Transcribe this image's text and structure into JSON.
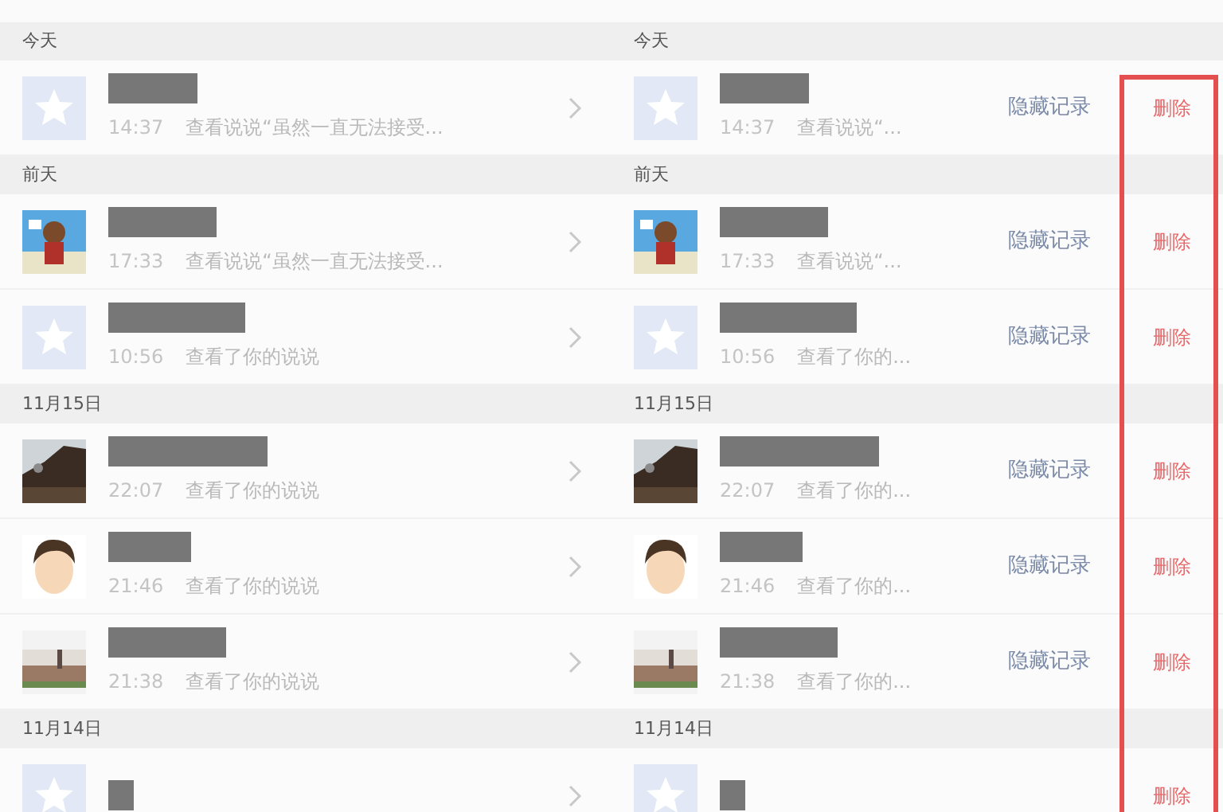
{
  "panels": [
    {
      "kind": "list",
      "sections": [
        {
          "date": "今天",
          "items": [
            {
              "kind": "star",
              "time": "14:37",
              "text": "查看说说“虽然一直无法接受..."
            }
          ]
        },
        {
          "date": "前天",
          "items": [
            {
              "time": "17:33",
              "text": "查看说说“虽然一直无法接受..."
            },
            {
              "kind": "star",
              "time": "10:56",
              "text": "查看了你的说说"
            }
          ]
        },
        {
          "date": "11月15日",
          "items": [
            {
              "time": "22:07",
              "text": "查看了你的说说"
            },
            {
              "time": "21:46",
              "text": "查看了你的说说"
            },
            {
              "time": "21:38",
              "text": "查看了你的说说"
            }
          ]
        },
        {
          "date": "11月14日",
          "items": [
            {
              "kind": "star"
            }
          ]
        }
      ]
    },
    {
      "kind": "swiped",
      "sections": [
        {
          "date": "今天",
          "items": [
            {
              "kind": "star",
              "time": "14:37",
              "text": "查看说说“...",
              "actions": [
                "隐藏记录",
                "删除"
              ]
            }
          ]
        },
        {
          "date": "前天",
          "items": [
            {
              "time": "17:33",
              "text": "查看说说“...",
              "actions": [
                "隐藏记录",
                "删除"
              ]
            },
            {
              "kind": "star",
              "time": "10:56",
              "text": "查看了你的...",
              "actions": [
                "隐藏记录",
                "删除"
              ]
            }
          ]
        },
        {
          "date": "11月15日",
          "items": [
            {
              "time": "22:07",
              "text": "查看了你的...",
              "actions": [
                "隐藏记录",
                "删除"
              ]
            },
            {
              "time": "21:46",
              "text": "查看了你的...",
              "actions": [
                "隐藏记录",
                "删除"
              ]
            },
            {
              "time": "21:38",
              "text": "查看了你的...",
              "actions": [
                "隐藏记录",
                "删除"
              ]
            }
          ]
        },
        {
          "date": "11月14日",
          "items": [
            {
              "kind": "star",
              "actions": [
                "删除"
              ]
            }
          ]
        }
      ]
    }
  ]
}
